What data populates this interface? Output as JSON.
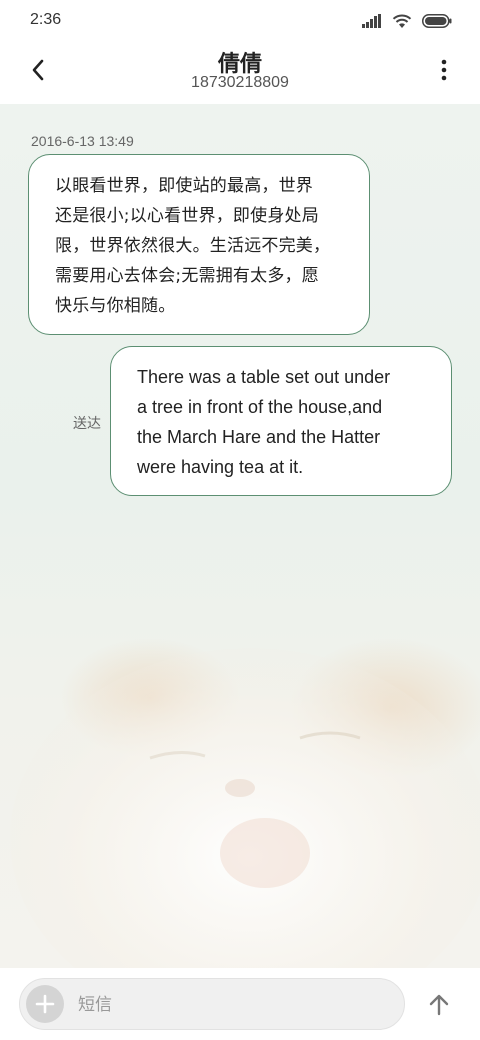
{
  "status_bar": {
    "time": "2:36"
  },
  "header": {
    "contact_name": "倩倩",
    "contact_number": "18730218809"
  },
  "conversation": {
    "timestamp": "2016-6-13 13:49",
    "messages": [
      {
        "direction": "incoming",
        "lines": [
          "以眼看世界，即使站的最高，世界",
          "还是很小;以心看世界，即使身处局",
          "限，世界依然很大。生活远不完美，",
          "需要用心去体会;无需拥有太多，愿",
          "快乐与你相随。"
        ]
      },
      {
        "direction": "outgoing",
        "lines": [
          "There was a table set out under",
          "a tree in front of the house,and",
          "the March Hare and the Hatter",
          "were having tea at it."
        ],
        "status": "送达"
      }
    ]
  },
  "composer": {
    "placeholder": "短信",
    "value": ""
  },
  "colors": {
    "bubble_border": "#5c8f72",
    "chat_background": "#eef3ef"
  },
  "icons": {
    "back": "back-arrow-icon",
    "more": "more-vertical-icon",
    "add": "plus-icon",
    "send": "send-arrow-icon",
    "signal": "signal-icon",
    "wifi": "wifi-icon",
    "battery": "battery-icon"
  }
}
